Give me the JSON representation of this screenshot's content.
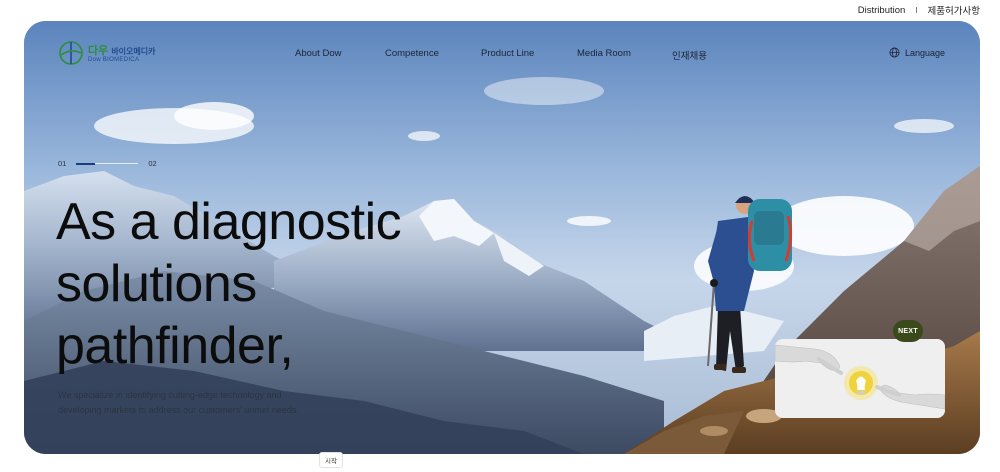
{
  "utility": {
    "distribution": "Distribution",
    "separator": "I",
    "approvals": "제품허가사항"
  },
  "logo": {
    "ko_main": "다우",
    "ko_sub": "바이오메디카",
    "en": "Dow BIOMEDICA"
  },
  "nav": {
    "items": [
      "About Dow",
      "Competence",
      "Product Line",
      "Media Room",
      "인재채용"
    ]
  },
  "language": {
    "label": "Language",
    "icon": "globe-icon"
  },
  "pager": {
    "current": "01",
    "next": "02",
    "progress": 0.3
  },
  "hero": {
    "headline": [
      "As a diagnostic",
      "solutions",
      "pathfinder,"
    ],
    "description": [
      "We specialize in identifying cutting-edge technology and",
      "developing markets to address our customers' unmet needs."
    ]
  },
  "next_card": {
    "label": "NEXT",
    "image": "hands-lightbulb-image"
  },
  "start_tag": "시작",
  "colors": {
    "accent_green": "#2b8f3a",
    "accent_blue": "#1f4c8f",
    "next_badge": "#3b4a1a"
  }
}
